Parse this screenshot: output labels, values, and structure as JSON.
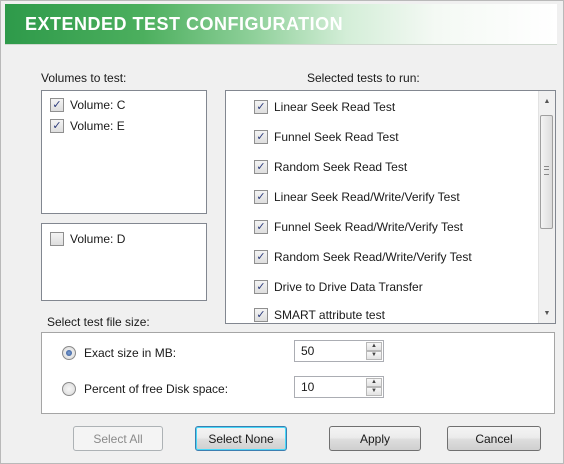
{
  "banner": {
    "title": "EXTENDED TEST CONFIGURATION"
  },
  "volumes": {
    "label": "Volumes to test:",
    "selected": [
      {
        "label": "Volume: C",
        "checked": true
      },
      {
        "label": "Volume: E",
        "checked": true
      }
    ],
    "unselected": [
      {
        "label": "Volume: D",
        "checked": false
      }
    ]
  },
  "tests": {
    "label": "Selected tests to run:",
    "items": [
      {
        "label": "Linear Seek Read Test",
        "checked": true
      },
      {
        "label": "Funnel Seek Read Test",
        "checked": true
      },
      {
        "label": "Random Seek Read Test",
        "checked": true
      },
      {
        "label": "Linear Seek Read/Write/Verify Test",
        "checked": true
      },
      {
        "label": "Funnel Seek Read/Write/Verify Test",
        "checked": true
      },
      {
        "label": "Random Seek Read/Write/Verify Test",
        "checked": true
      },
      {
        "label": "Drive to Drive Data Transfer",
        "checked": true
      },
      {
        "label": "SMART attribute test",
        "checked": true
      }
    ]
  },
  "file_size": {
    "label": "Select test file size:",
    "exact": {
      "label": "Exact size in MB:",
      "value": "50",
      "selected": true
    },
    "percent": {
      "label": "Percent of free Disk space:",
      "value": "10",
      "selected": false
    }
  },
  "buttons": {
    "select_all": "Select All",
    "select_none": "Select None",
    "apply": "Apply",
    "cancel": "Cancel"
  },
  "glyphs": {
    "check": "✓",
    "up": "▲",
    "down": "▼"
  }
}
